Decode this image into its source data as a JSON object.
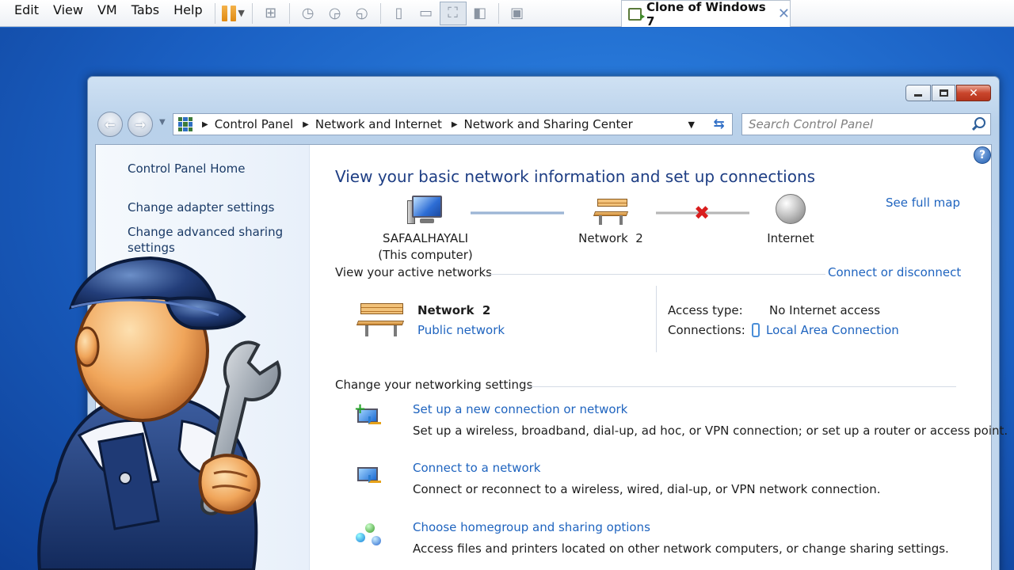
{
  "host": {
    "menu": [
      "Edit",
      "View",
      "VM",
      "Tabs",
      "Help"
    ],
    "tab_title": "Clone of Windows 7",
    "tab_close": "✕"
  },
  "window": {
    "breadcrumb": [
      "Control Panel",
      "Network and Internet",
      "Network and Sharing Center"
    ],
    "search_placeholder": "Search Control Panel",
    "help": "?"
  },
  "left_pane": {
    "home": "Control Panel Home",
    "adapter": "Change adapter settings",
    "advanced": "Change advanced sharing settings"
  },
  "main": {
    "title": "View your basic network information and set up connections",
    "see_full_map": "See full map",
    "map": {
      "computer_name": "SAFAALHAYALI",
      "computer_sub": "(This computer)",
      "network": "Network  2",
      "internet": "Internet"
    },
    "active_networks": {
      "heading": "View your active networks",
      "connect_link": "Connect or disconnect",
      "network_name": "Network  2",
      "network_type": "Public network",
      "access_type_label": "Access type:",
      "access_type_value": "No Internet access",
      "connections_label": "Connections:",
      "connections_value": "Local Area Connection"
    },
    "change_settings": {
      "heading": "Change your networking settings",
      "tasks": [
        {
          "title": "Set up a new connection or network",
          "desc": "Set up a wireless, broadband, dial-up, ad hoc, or VPN connection; or set up a router or access point."
        },
        {
          "title": "Connect to a network",
          "desc": "Connect or reconnect to a wireless, wired, dial-up, or VPN network connection."
        },
        {
          "title": "Choose homegroup and sharing options",
          "desc": "Access files and printers located on other network computers, or change sharing settings."
        }
      ]
    }
  },
  "colors": {
    "link": "#1f64bf",
    "title": "#1e3e84",
    "desktop": "#1a5fc2",
    "close_button": "#c9452c",
    "error_x": "#d91d1d"
  }
}
